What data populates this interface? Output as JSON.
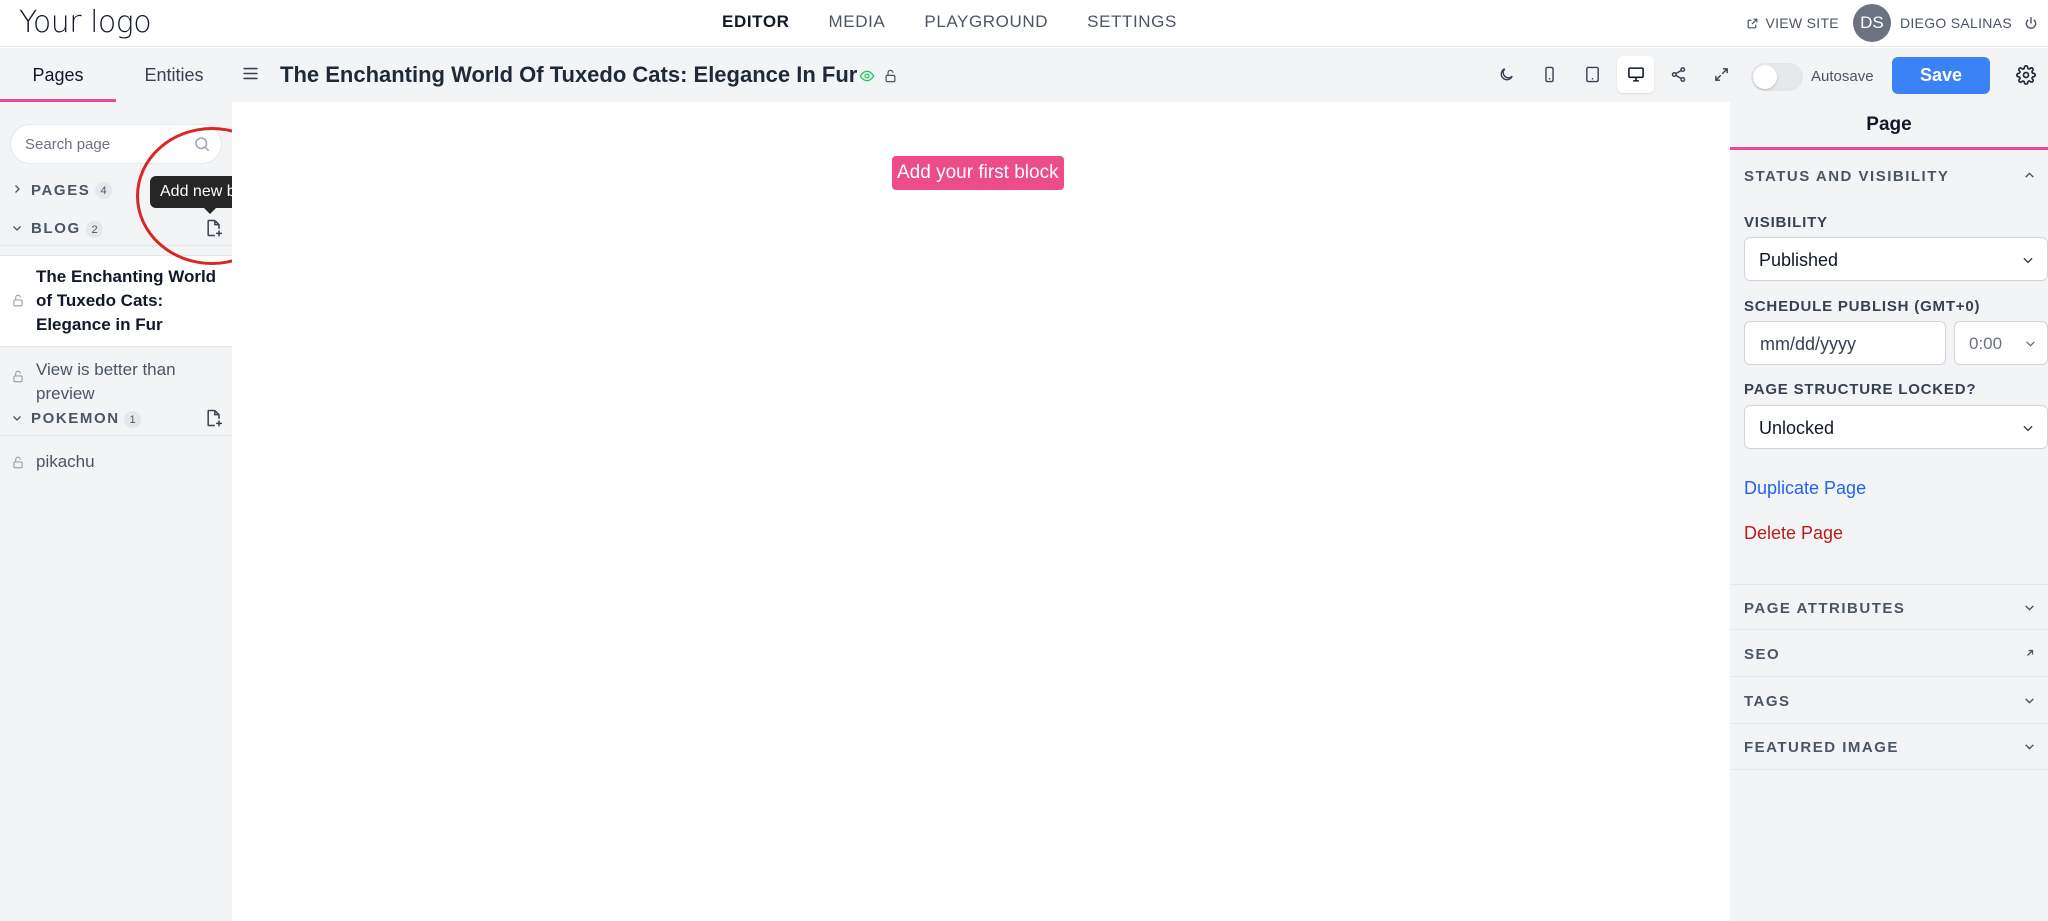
{
  "topnav": {
    "logo": "Your logo",
    "nav": [
      "EDITOR",
      "MEDIA",
      "PLAYGROUND",
      "SETTINGS"
    ],
    "active_nav": "EDITOR",
    "view_site": "VIEW SITE",
    "user_initials": "DS",
    "user_name": "DIEGO SALINAS"
  },
  "sidebar": {
    "tabs": [
      "Pages",
      "Entities"
    ],
    "active_tab": "Pages",
    "search_placeholder": "Search page",
    "sections": [
      {
        "label": "PAGES",
        "count": "4",
        "expanded": false
      },
      {
        "label": "BLOG",
        "count": "2",
        "expanded": true
      },
      {
        "label": "POKEMON",
        "count": "1",
        "expanded": true
      }
    ],
    "blog_items": [
      "The Enchanting World of Tuxedo Cats: Elegance in Fur",
      "View is better than preview"
    ],
    "pokemon_items": [
      "pikachu"
    ],
    "tooltip": "Add new blog"
  },
  "editor": {
    "page_title": "The Enchanting World Of Tuxedo Cats: Elegance In Fur",
    "autosave_label": "Autosave",
    "autosave_on": false,
    "save_label": "Save",
    "active_device": "desktop",
    "add_first_block": "Add your first block"
  },
  "panel": {
    "title": "Page",
    "status_section": "STATUS AND VISIBILITY",
    "visibility_label": "VISIBILITY",
    "visibility_value": "Published",
    "schedule_label": "SCHEDULE PUBLISH (GMT+0)",
    "date_placeholder": "mm/dd/yyyy",
    "time_value": "0:00",
    "locked_label": "PAGE STRUCTURE LOCKED?",
    "locked_value": "Unlocked",
    "duplicate_label": "Duplicate Page",
    "delete_label": "Delete Page",
    "collapsed_sections": [
      "PAGE ATTRIBUTES",
      "SEO",
      "TAGS",
      "FEATURED IMAGE"
    ]
  },
  "colors": {
    "accent_pink": "#ec4899",
    "primary_blue": "#3b82f6",
    "danger_red": "#b91c1c",
    "annotation_red": "#dc2626"
  }
}
